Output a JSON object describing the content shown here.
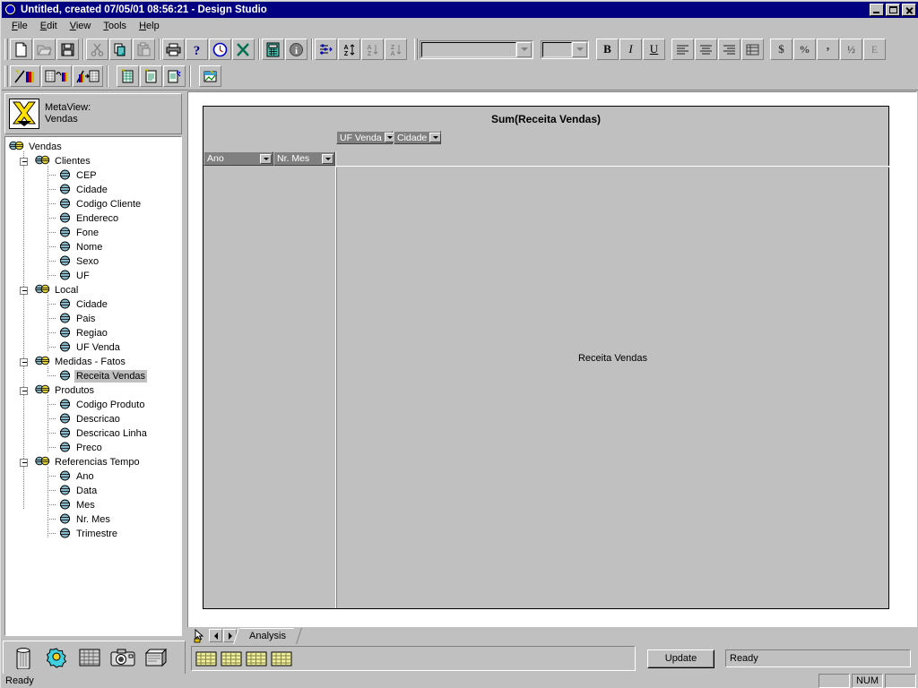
{
  "window": {
    "title": "Untitled, created 07/05/01 08:56:21 - Design Studio",
    "icon": "app-logo-icon",
    "minimize_label": "Minimize",
    "maximize_label": "Restore",
    "close_label": "Close"
  },
  "menubar": {
    "items": [
      {
        "label": "File",
        "accel": "F"
      },
      {
        "label": "Edit",
        "accel": "E"
      },
      {
        "label": "View",
        "accel": "V"
      },
      {
        "label": "Tools",
        "accel": "T"
      },
      {
        "label": "Help",
        "accel": "H"
      }
    ]
  },
  "toolbar_row1": [
    {
      "name": "new-icon",
      "tip": "New"
    },
    {
      "name": "open-icon",
      "tip": "Open"
    },
    {
      "name": "save-icon",
      "tip": "Save"
    },
    {
      "sep": true
    },
    {
      "name": "cut-icon",
      "tip": "Cut"
    },
    {
      "name": "copy-icon",
      "tip": "Copy"
    },
    {
      "name": "paste-icon",
      "tip": "Paste"
    },
    {
      "sep": true
    },
    {
      "name": "print-icon",
      "tip": "Print"
    },
    {
      "name": "help-question-icon",
      "tip": "Help"
    },
    {
      "name": "clock-icon",
      "tip": "Schedule"
    },
    {
      "name": "excel-export-icon",
      "tip": "Export to Excel"
    },
    {
      "sep": true
    },
    {
      "name": "calculator-icon",
      "tip": "Calculator"
    },
    {
      "name": "info-icon",
      "tip": "Information"
    },
    {
      "sep": true
    },
    {
      "name": "filter-icon",
      "tip": "Filter"
    },
    {
      "name": "sort-az-icon",
      "tip": "Sort"
    },
    {
      "name": "sort-ascending-icon",
      "tip": "Sort Ascending"
    },
    {
      "name": "sort-descending-icon",
      "tip": "Sort Descending"
    }
  ],
  "toolbar_format": {
    "font_name": "",
    "font_size": "",
    "bold_label": "B",
    "italic_label": "I",
    "underline_label": "U",
    "align_left": "align-left-icon",
    "align_center": "align-center-icon",
    "align_right": "align-right-icon",
    "merge": "merge-cells-icon",
    "currency_label": "$",
    "percent_label": "%",
    "comma_label": ",",
    "fraction_label": "½",
    "exponent_label": "E"
  },
  "toolbar_row2": [
    {
      "name": "new-chart-icon",
      "tip": "New Chart"
    },
    {
      "name": "grid-to-chart-icon",
      "tip": "Grid and Chart"
    },
    {
      "name": "chart-to-grid-icon",
      "tip": "Chart to Grid"
    },
    {
      "sep": true
    },
    {
      "name": "new-report-icon",
      "tip": "New Report"
    },
    {
      "name": "new-document-icon",
      "tip": "New Document"
    },
    {
      "name": "report-wizard-icon",
      "tip": "Report Wizard"
    },
    {
      "sep": true
    },
    {
      "name": "image-edit-icon",
      "tip": "Edit Image"
    }
  ],
  "metaview": {
    "icon": "metaview-icon",
    "line1": "MetaView:",
    "line2": "Vendas"
  },
  "tree": {
    "root": {
      "label": "Vendas",
      "icon": "folder-cube-icon"
    },
    "groups": [
      {
        "label": "Clientes",
        "icon": "dimension-icon",
        "expanded": true,
        "children": [
          {
            "label": "CEP",
            "icon": "attribute-icon"
          },
          {
            "label": "Cidade",
            "icon": "attribute-icon"
          },
          {
            "label": "Codigo Cliente",
            "icon": "attribute-icon"
          },
          {
            "label": "Endereco",
            "icon": "attribute-icon"
          },
          {
            "label": "Fone",
            "icon": "attribute-icon"
          },
          {
            "label": "Nome",
            "icon": "attribute-icon"
          },
          {
            "label": "Sexo",
            "icon": "attribute-icon"
          },
          {
            "label": "UF",
            "icon": "attribute-icon"
          }
        ]
      },
      {
        "label": "Local",
        "icon": "dimension-icon",
        "expanded": true,
        "children": [
          {
            "label": "Cidade",
            "icon": "attribute-icon"
          },
          {
            "label": "Pais",
            "icon": "attribute-icon"
          },
          {
            "label": "Regiao",
            "icon": "attribute-icon"
          },
          {
            "label": "UF Venda",
            "icon": "attribute-icon"
          }
        ]
      },
      {
        "label": "Medidas - Fatos",
        "icon": "dimension-icon",
        "expanded": true,
        "children": [
          {
            "label": "Receita Vendas",
            "icon": "attribute-icon",
            "selected": true
          }
        ]
      },
      {
        "label": "Produtos",
        "icon": "dimension-icon",
        "expanded": true,
        "children": [
          {
            "label": "Codigo Produto",
            "icon": "attribute-icon"
          },
          {
            "label": "Descricao",
            "icon": "attribute-icon"
          },
          {
            "label": "Descricao Linha",
            "icon": "attribute-icon"
          },
          {
            "label": "Preco",
            "icon": "attribute-icon"
          }
        ]
      },
      {
        "label": "Referencias Tempo",
        "icon": "dimension-icon",
        "expanded": true,
        "children": [
          {
            "label": "Ano",
            "icon": "attribute-icon"
          },
          {
            "label": "Data",
            "icon": "attribute-icon"
          },
          {
            "label": "Mes",
            "icon": "attribute-icon"
          },
          {
            "label": "Nr. Mes",
            "icon": "attribute-icon"
          },
          {
            "label": "Trimestre",
            "icon": "attribute-icon"
          }
        ]
      }
    ]
  },
  "left_toolbar": [
    {
      "name": "trash-icon",
      "tip": "Delete"
    },
    {
      "name": "settings-gear-icon",
      "tip": "Properties"
    },
    {
      "name": "grid-view-icon",
      "tip": "Grid"
    },
    {
      "name": "camera-icon",
      "tip": "Snapshot"
    },
    {
      "name": "archive-icon",
      "tip": "Archive"
    }
  ],
  "analysis": {
    "title": "Sum(Receita Vendas)",
    "page_dimensions": [
      {
        "label": "UF Venda",
        "icon": "chevron-down-icon"
      },
      {
        "label": "Cidade",
        "icon": "chevron-down-icon"
      }
    ],
    "row_dimensions": [
      {
        "label": "Ano",
        "icon": "chevron-down-icon"
      },
      {
        "label": "Nr. Mes",
        "icon": "chevron-down-icon"
      }
    ],
    "measure_label": "Receita Vendas"
  },
  "tabstrip": {
    "hand_icon": "pointer-hand-icon",
    "prev_label": "Previous",
    "next_label": "Next",
    "tabs": [
      {
        "label": "Analysis",
        "active": true
      }
    ]
  },
  "commandbar": {
    "sheet_buttons": [
      {
        "name": "sheet-grid-icon-1"
      },
      {
        "name": "sheet-grid-icon-2"
      },
      {
        "name": "sheet-grid-icon-3"
      },
      {
        "name": "sheet-grid-icon-4"
      }
    ],
    "update_label": "Update",
    "status_value": "Ready"
  },
  "statusbar": {
    "message": "Ready",
    "panel1": "",
    "panel2": "NUM",
    "panel3": ""
  },
  "colors": {
    "desktop": "#c0c0c0",
    "titlebar": "#000080",
    "titlebar_text": "#ffffff",
    "dim_header": "#808080",
    "dim_header_text": "#ffffff",
    "selection": "#c0c0c0",
    "tree_bg": "#ffffff"
  }
}
